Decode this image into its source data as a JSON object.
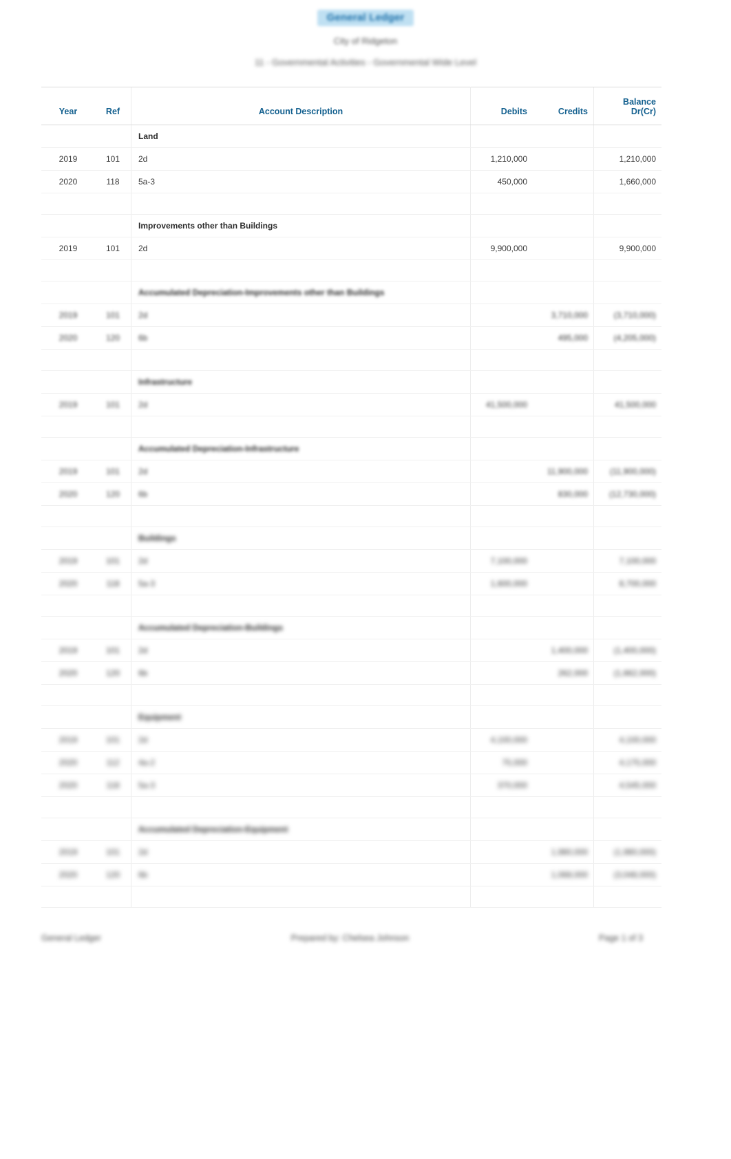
{
  "report": {
    "title": "General Ledger",
    "subtitle": "City of Ridgeton",
    "subtitle2": "11 - Governmental Activities - Governmental Wide Level"
  },
  "table": {
    "columns": [
      {
        "key": "year",
        "label": "Year"
      },
      {
        "key": "ref",
        "label": "Ref"
      },
      {
        "key": "desc",
        "label": "Account Description"
      },
      {
        "key": "debits",
        "label": "Debits"
      },
      {
        "key": "credits",
        "label": "Credits"
      },
      {
        "key": "balance_line1",
        "label": "Balance"
      },
      {
        "key": "balance_line2",
        "label": "Dr(Cr)"
      }
    ],
    "sections": [
      {
        "name": "Land",
        "blur": 0,
        "rows": [
          {
            "year": "2019",
            "ref": "101",
            "desc": "2d",
            "debits": "1,210,000",
            "credits": "",
            "balance": "1,210,000"
          },
          {
            "year": "2020",
            "ref": "118",
            "desc": "5a-3",
            "debits": "450,000",
            "credits": "",
            "balance": "1,660,000"
          }
        ]
      },
      {
        "name": "Improvements other than Buildings",
        "blur": 0,
        "rows": [
          {
            "year": "2019",
            "ref": "101",
            "desc": "2d",
            "debits": "9,900,000",
            "credits": "",
            "balance": "9,900,000"
          }
        ]
      },
      {
        "name": "Accumulated Depreciation-Improvements other than Buildings",
        "blur": 2,
        "rows": [
          {
            "year": "2019",
            "ref": "101",
            "desc": "2d",
            "debits": "",
            "credits": "3,710,000",
            "balance": "(3,710,000)"
          },
          {
            "year": "2020",
            "ref": "120",
            "desc": "6b",
            "debits": "",
            "credits": "495,000",
            "balance": "(4,205,000)"
          }
        ]
      },
      {
        "name": "Infrastructure",
        "blur": 3,
        "rows": [
          {
            "year": "2019",
            "ref": "101",
            "desc": "2d",
            "debits": "41,500,000",
            "credits": "",
            "balance": "41,500,000"
          }
        ]
      },
      {
        "name": "Accumulated Depreciation-Infrastructure",
        "blur": 3,
        "rows": [
          {
            "year": "2019",
            "ref": "101",
            "desc": "2d",
            "debits": "",
            "credits": "11,900,000",
            "balance": "(11,900,000)"
          },
          {
            "year": "2020",
            "ref": "120",
            "desc": "6b",
            "debits": "",
            "credits": "830,000",
            "balance": "(12,730,000)"
          }
        ]
      },
      {
        "name": "Buildings",
        "blur": 4,
        "rows": [
          {
            "year": "2019",
            "ref": "101",
            "desc": "2d",
            "debits": "7,100,000",
            "credits": "",
            "balance": "7,100,000"
          },
          {
            "year": "2020",
            "ref": "118",
            "desc": "5a-3",
            "debits": "1,600,000",
            "credits": "",
            "balance": "8,700,000"
          }
        ]
      },
      {
        "name": "Accumulated Depreciation-Buildings",
        "blur": 4,
        "rows": [
          {
            "year": "2019",
            "ref": "101",
            "desc": "2d",
            "debits": "",
            "credits": "1,400,000",
            "balance": "(1,400,000)"
          },
          {
            "year": "2020",
            "ref": "120",
            "desc": "6b",
            "debits": "",
            "credits": "262,000",
            "balance": "(1,662,000)"
          }
        ]
      },
      {
        "name": "Equipment",
        "blur": 5,
        "rows": [
          {
            "year": "2019",
            "ref": "101",
            "desc": "2d",
            "debits": "4,100,000",
            "credits": "",
            "balance": "4,100,000"
          },
          {
            "year": "2020",
            "ref": "112",
            "desc": "4a-2",
            "debits": "75,000",
            "credits": "",
            "balance": "4,175,000"
          },
          {
            "year": "2020",
            "ref": "118",
            "desc": "5a-3",
            "debits": "370,000",
            "credits": "",
            "balance": "4,545,000"
          }
        ]
      },
      {
        "name": "Accumulated Depreciation-Equipment",
        "blur": 5,
        "rows": [
          {
            "year": "2019",
            "ref": "101",
            "desc": "2d",
            "debits": "",
            "credits": "1,980,000",
            "balance": "(1,980,000)"
          },
          {
            "year": "2020",
            "ref": "120",
            "desc": "6b",
            "debits": "",
            "credits": "1,068,000",
            "balance": "(3,048,000)"
          }
        ]
      }
    ]
  },
  "footer": {
    "left": "General Ledger",
    "center": "Prepared by: Chelsea Johnson",
    "right": "Page 1 of 3"
  },
  "colors": {
    "header_text": "#13608f",
    "title_highlight": "#bfe0f2",
    "body_text": "#3b3b3b"
  }
}
